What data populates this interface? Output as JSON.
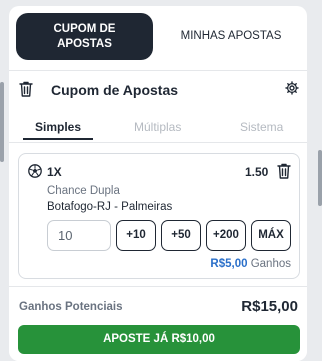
{
  "tabs": {
    "active_line1": "CUPOM DE",
    "active_line2": "APOSTAS",
    "inactive": "MINHAS APOSTAS"
  },
  "header": {
    "title": "Cupom de Apostas"
  },
  "modes": {
    "items": [
      "Simples",
      "Múltiplas",
      "Sistema"
    ],
    "selected": "Simples"
  },
  "bet": {
    "count": "1X",
    "odd": "1.50",
    "market": "Chance Dupla",
    "match": "Botafogo-RJ - Palmeiras",
    "stake_value": "10",
    "quick_buttons": [
      "+10",
      "+50",
      "+200",
      "MÁX"
    ],
    "gain_amount": "R$5,00",
    "gain_label": "Ganhos"
  },
  "footer": {
    "potential_label": "Ganhos Potenciais",
    "potential_value": "R$15,00",
    "cta_label": "APOSTE JÁ R$10,00"
  },
  "colors": {
    "dark": "#1f2733",
    "accent_blue": "#2a6fc9",
    "cta_green": "#27923a",
    "muted": "#b5bac1"
  },
  "icons": [
    "trash-icon",
    "gear-icon",
    "soccer-ball-icon"
  ]
}
